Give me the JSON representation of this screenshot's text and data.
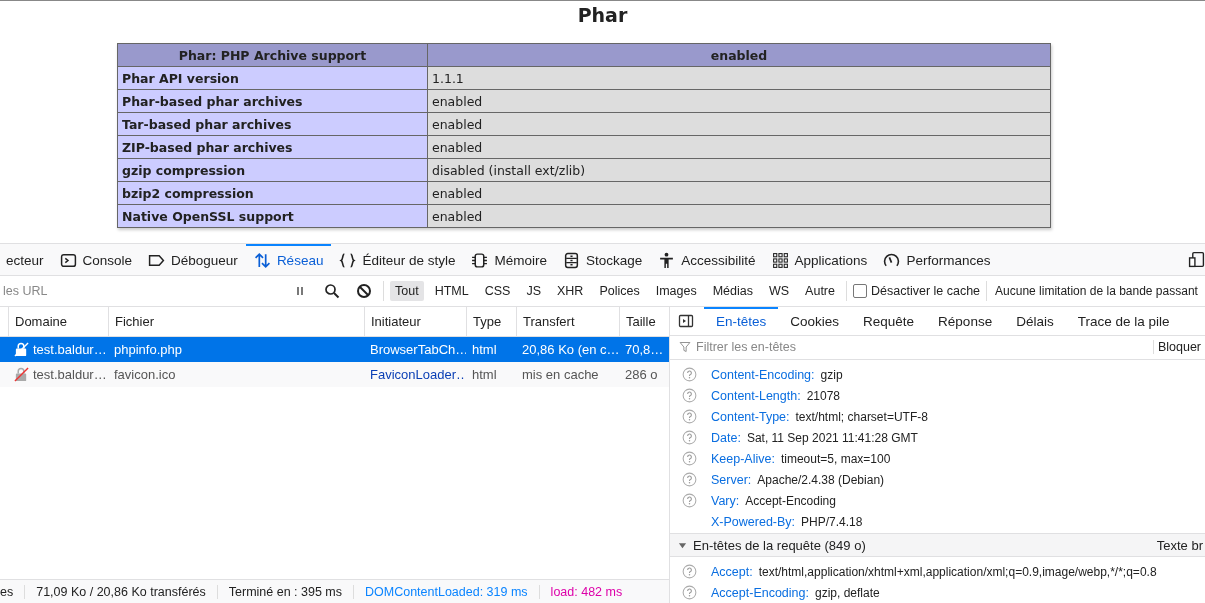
{
  "page": {
    "title": "Phar",
    "table": {
      "header": [
        "Phar: PHP Archive support",
        "enabled"
      ],
      "rows": [
        {
          "label": "Phar API version",
          "value": "1.1.1"
        },
        {
          "label": "Phar-based phar archives",
          "value": "enabled"
        },
        {
          "label": "Tar-based phar archives",
          "value": "enabled"
        },
        {
          "label": "ZIP-based phar archives",
          "value": "enabled"
        },
        {
          "label": "gzip compression",
          "value": "disabled (install ext/zlib)"
        },
        {
          "label": "bzip2 compression",
          "value": "enabled"
        },
        {
          "label": "Native OpenSSL support",
          "value": "enabled"
        }
      ]
    }
  },
  "devtools": {
    "tabs": [
      {
        "label": "ecteur",
        "kind": "none",
        "selected": false
      },
      {
        "label": "Console",
        "kind": "console",
        "selected": false
      },
      {
        "label": "Débogueur",
        "kind": "debugger",
        "selected": false
      },
      {
        "label": "Réseau",
        "kind": "network",
        "selected": true
      },
      {
        "label": "Éditeur de style",
        "kind": "style",
        "selected": false
      },
      {
        "label": "Mémoire",
        "kind": "memory",
        "selected": false
      },
      {
        "label": "Stockage",
        "kind": "storage",
        "selected": false
      },
      {
        "label": "Accessibilité",
        "kind": "accessibility",
        "selected": false
      },
      {
        "label": "Applications",
        "kind": "applications",
        "selected": false
      },
      {
        "label": "Performances",
        "kind": "performance",
        "selected": false
      }
    ],
    "filter": {
      "placeholder": "les URL"
    },
    "types": [
      {
        "label": "Tout",
        "selected": true
      },
      {
        "label": "HTML",
        "selected": false
      },
      {
        "label": "CSS",
        "selected": false
      },
      {
        "label": "JS",
        "selected": false
      },
      {
        "label": "XHR",
        "selected": false
      },
      {
        "label": "Polices",
        "selected": false
      },
      {
        "label": "Images",
        "selected": false
      },
      {
        "label": "Médias",
        "selected": false
      },
      {
        "label": "WS",
        "selected": false
      },
      {
        "label": "Autre",
        "selected": false
      }
    ],
    "disable_cache": {
      "label": "Désactiver le cache",
      "checked": false
    },
    "throttling": "Aucune limitation de la bande passant",
    "columns": [
      "Domaine",
      "Fichier",
      "Initiateur",
      "Type",
      "Transfert",
      "Taille"
    ],
    "requests": [
      {
        "domain": "test.baldur…",
        "file": "phpinfo.php",
        "initiator": "BrowserTabCh…",
        "type": "html",
        "transfer": "20,86 Ko (en c…",
        "size": "70,8…",
        "selected": true
      },
      {
        "domain": "test.baldur…",
        "file": "favicon.ico",
        "initiator": "FaviconLoader…",
        "type": "html",
        "transfer": "mis en cache",
        "size": "286 o",
        "selected": false
      }
    ],
    "status": [
      {
        "text": "es",
        "kind": "plain"
      },
      {
        "text": "71,09 Ko / 20,86 Ko transférés",
        "kind": "plain"
      },
      {
        "text": "Terminé en : 395 ms",
        "kind": "plain"
      },
      {
        "text": "DOMContentLoaded: 319 ms",
        "kind": "dom"
      },
      {
        "text": "load: 482 ms",
        "kind": "load"
      }
    ],
    "detail_tabs": [
      {
        "label": "En-têtes",
        "selected": true
      },
      {
        "label": "Cookies",
        "selected": false
      },
      {
        "label": "Requête",
        "selected": false
      },
      {
        "label": "Réponse",
        "selected": false
      },
      {
        "label": "Délais",
        "selected": false
      },
      {
        "label": "Trace de la pile",
        "selected": false
      }
    ],
    "header_filter": {
      "placeholder": "Filtrer les en-têtes",
      "block": "Bloquer"
    },
    "response_headers": [
      {
        "name": "Content-Encoding:",
        "value": "gzip",
        "help": true
      },
      {
        "name": "Content-Length:",
        "value": "21078",
        "help": true
      },
      {
        "name": "Content-Type:",
        "value": "text/html; charset=UTF-8",
        "help": true
      },
      {
        "name": "Date:",
        "value": "Sat, 11 Sep 2021 11:41:28 GMT",
        "help": true
      },
      {
        "name": "Keep-Alive:",
        "value": "timeout=5, max=100",
        "help": true
      },
      {
        "name": "Server:",
        "value": "Apache/2.4.38 (Debian)",
        "help": true
      },
      {
        "name": "Vary:",
        "value": "Accept-Encoding",
        "help": true
      },
      {
        "name": "X-Powered-By:",
        "value": "PHP/7.4.18",
        "help": false
      }
    ],
    "request_section": {
      "title": "En-têtes de la requête (849 o)",
      "expanded": true,
      "raw_toggle": "Texte br"
    },
    "request_headers": [
      {
        "name": "Accept:",
        "value": "text/html,application/xhtml+xml,application/xml;q=0.9,image/webp,*/*;q=0.8",
        "help": true
      },
      {
        "name": "Accept-Encoding:",
        "value": "gzip, deflate",
        "help": true
      }
    ]
  }
}
